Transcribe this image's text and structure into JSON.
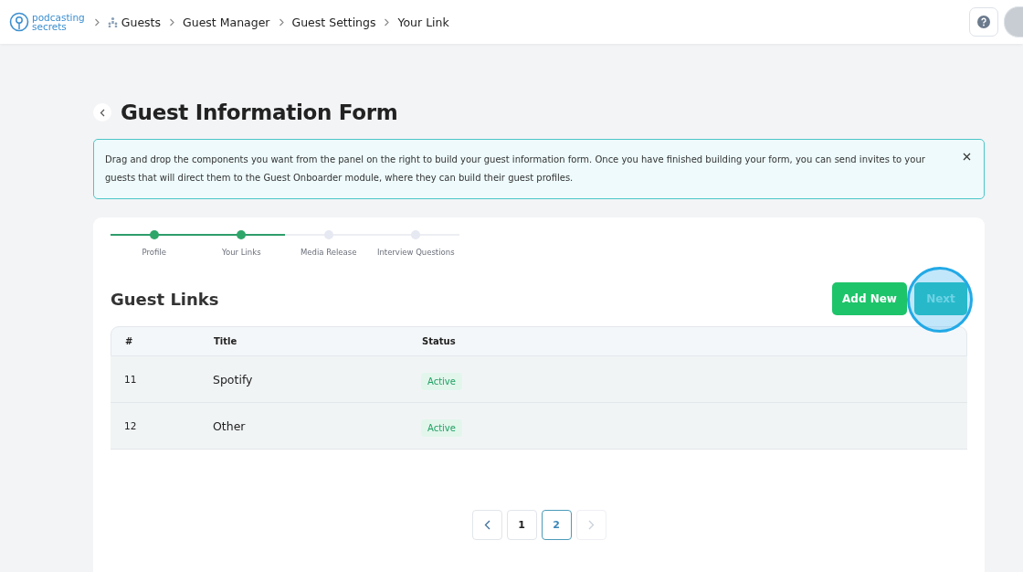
{
  "header": {
    "logo": {
      "line1": "podcasting",
      "line2": "secrets"
    },
    "breadcrumbs": [
      {
        "label": "Guests",
        "icon": true
      },
      {
        "label": "Guest Manager",
        "icon": false
      },
      {
        "label": "Guest Settings",
        "icon": false
      },
      {
        "label": "Your Link",
        "icon": false
      }
    ]
  },
  "page": {
    "title": "Guest Information Form",
    "notice": "Drag and drop the components you want from the panel on the right to build your guest information form. Once you have finished building your form, you can send invites to your guests that will direct them to the Guest Onboarder module, where they can build their guest profiles."
  },
  "steps": [
    {
      "label": "Profile",
      "completed": true
    },
    {
      "label": "Your Links",
      "completed": true
    },
    {
      "label": "Media Release",
      "completed": false
    },
    {
      "label": "Interview Questions",
      "completed": false
    }
  ],
  "section": {
    "title": "Guest Links",
    "buttons": [
      {
        "label": "Add New",
        "kind": "primary",
        "highlighted": false
      },
      {
        "label": "Next",
        "kind": "secondary",
        "highlighted": true
      }
    ]
  },
  "table": {
    "columns": [
      "#",
      "Title",
      "Status"
    ],
    "rows": [
      {
        "number": "11",
        "title": "Spotify",
        "status": "Active"
      },
      {
        "number": "12",
        "title": "Other",
        "status": "Active"
      }
    ]
  },
  "pagination": {
    "prev_disabled": false,
    "next_disabled": true,
    "pages": [
      {
        "label": "1",
        "selected": false
      },
      {
        "label": "2",
        "selected": true
      }
    ]
  }
}
